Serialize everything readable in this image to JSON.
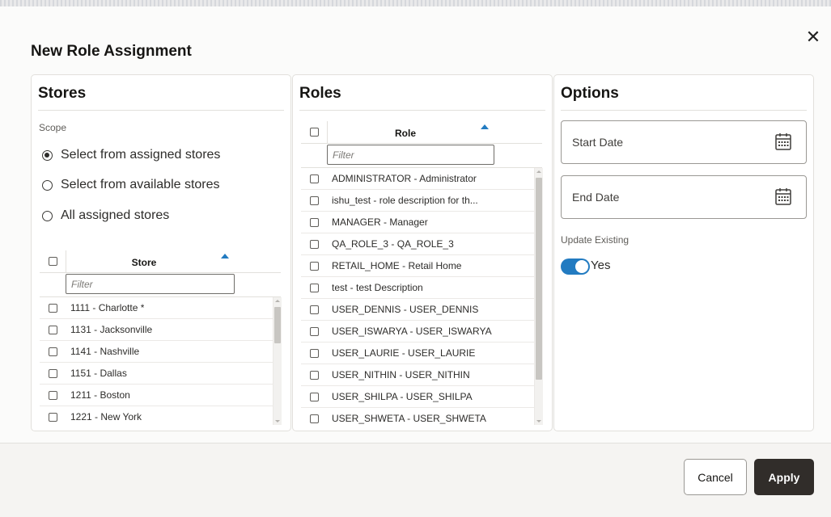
{
  "dialog": {
    "title": "New Role Assignment",
    "close_glyph": "✕"
  },
  "stores": {
    "title": "Stores",
    "scope_label": "Scope",
    "scope_options": [
      {
        "label": "Select from assigned stores",
        "checked": true
      },
      {
        "label": "Select from available stores",
        "checked": false
      },
      {
        "label": "All assigned stores",
        "checked": false
      }
    ],
    "grid": {
      "column": "Store",
      "sort": "ascending",
      "filter_placeholder": "Filter",
      "rows": [
        "1111 - Charlotte *",
        "1131 - Jacksonville",
        "1141 - Nashville",
        "1151 - Dallas",
        "1211 - Boston",
        "1221 - New York"
      ]
    }
  },
  "roles": {
    "title": "Roles",
    "grid": {
      "column": "Role",
      "sort": "ascending",
      "filter_placeholder": "Filter",
      "rows": [
        "ADMINISTRATOR - Administrator",
        "ishu_test - role description for th...",
        "MANAGER - Manager",
        "QA_ROLE_3 - QA_ROLE_3",
        "RETAIL_HOME - Retail Home",
        "test - test Description",
        "USER_DENNIS - USER_DENNIS",
        "USER_ISWARYA - USER_ISWARYA",
        "USER_LAURIE - USER_LAURIE",
        "USER_NITHIN - USER_NITHIN",
        "USER_SHILPA - USER_SHILPA",
        "USER_SHWETA - USER_SHWETA"
      ]
    }
  },
  "options": {
    "title": "Options",
    "start_date_label": "Start Date",
    "end_date_label": "End Date",
    "update_existing_label": "Update Existing",
    "update_existing_on": true,
    "update_existing_value": "Yes"
  },
  "footer": {
    "cancel_label": "Cancel",
    "apply_label": "Apply"
  },
  "icons": {
    "close": "close-icon",
    "calendar": "calendar-icon",
    "sort": "sort-ascending-icon"
  },
  "colors": {
    "accent": "#227bc1",
    "primary_button": "#312d2a"
  }
}
